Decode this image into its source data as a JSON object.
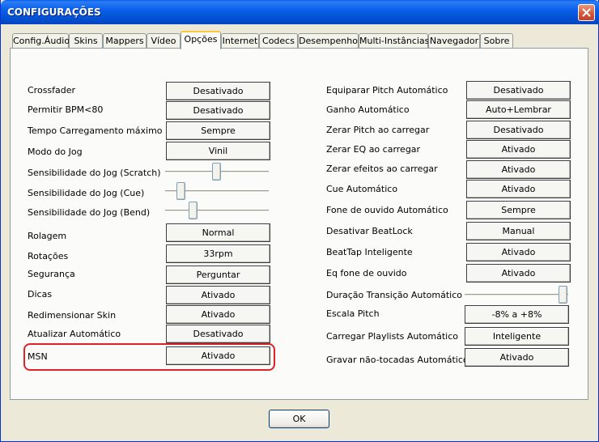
{
  "window": {
    "title": "CONFIGURAÇÕES"
  },
  "tabs": [
    {
      "label": "Config.Áudio"
    },
    {
      "label": "Skins"
    },
    {
      "label": "Mappers"
    },
    {
      "label": "Vídeo"
    },
    {
      "label": "Opções"
    },
    {
      "label": "Internet"
    },
    {
      "label": "Codecs"
    },
    {
      "label": "Desempenho"
    },
    {
      "label": "Multi-Instâncias"
    },
    {
      "label": "Navegador"
    },
    {
      "label": "Sobre"
    }
  ],
  "active_tab": "Opções",
  "left": [
    {
      "label": "Crossfader",
      "value": "Desativado"
    },
    {
      "label": "Permitir BPM<80",
      "value": "Desativado"
    },
    {
      "label": "Tempo Carregamento máximo",
      "value": "Sempre"
    },
    {
      "label": "Modo do Jog",
      "value": "Vinil"
    },
    {
      "label": "Sensibilidade do Jog (Scratch)",
      "slider": 0.5
    },
    {
      "label": "Sensibilidade do Jog (Cue)",
      "slider": 0.15
    },
    {
      "label": "Sensibilidade do Jog (Bend)",
      "slider": 0.27
    },
    {
      "label": "Rolagem",
      "value": "Normal"
    },
    {
      "label": "Rotações",
      "value": "33rpm"
    },
    {
      "label": "Segurança",
      "value": "Perguntar"
    },
    {
      "label": "Dicas",
      "value": "Ativado"
    },
    {
      "label": "Redimensionar Skin",
      "value": "Ativado"
    },
    {
      "label": "Atualizar Automático",
      "value": "Desativado"
    },
    {
      "label": "MSN",
      "value": "Ativado"
    }
  ],
  "right": [
    {
      "label": "Equiparar Pitch Automático",
      "value": "Desativado"
    },
    {
      "label": "Ganho Automático",
      "value": "Auto+Lembrar"
    },
    {
      "label": "Zerar Pitch ao carregar",
      "value": "Desativado"
    },
    {
      "label": "Zerar EQ ao carregar",
      "value": "Ativado"
    },
    {
      "label": "Zerar efeitos ao carregar",
      "value": "Ativado"
    },
    {
      "label": "Cue Automático",
      "value": "Ativado"
    },
    {
      "label": "Fone de ouvido Automático",
      "value": "Sempre"
    },
    {
      "label": "Desativar BeatLock",
      "value": "Manual"
    },
    {
      "label": "BeatTap Inteligente",
      "value": "Ativado"
    },
    {
      "label": "Eq fone de ouvido",
      "value": "Ativado"
    },
    {
      "label": "Duração Transição Automático",
      "slider": 0.98
    },
    {
      "label": "Escala Pitch",
      "value": "-8% a +8%"
    },
    {
      "label": "Carregar Playlists Automático",
      "value": "Inteligente"
    },
    {
      "label": "Gravar não-tocadas Automático",
      "value": "Ativado"
    }
  ],
  "footer": {
    "ok_label": "OK"
  }
}
